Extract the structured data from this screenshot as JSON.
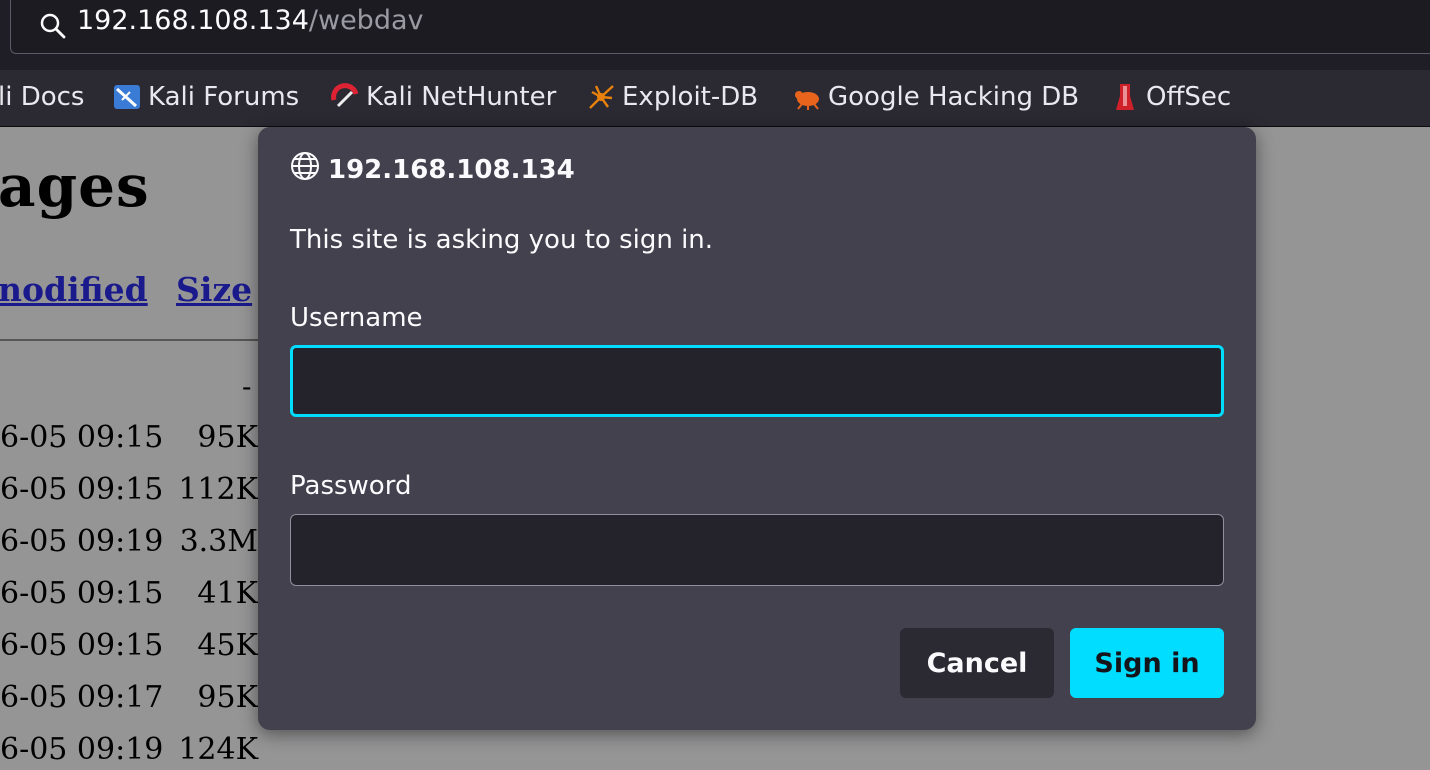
{
  "urlbar": {
    "host": "192.168.108.134",
    "path": "/webdav"
  },
  "bookmarks": [
    {
      "label": "li Docs",
      "icon": "kali-docs-icon"
    },
    {
      "label": "Kali Forums",
      "icon": "kali-forums-icon"
    },
    {
      "label": "Kali NetHunter",
      "icon": "kali-nethunter-icon"
    },
    {
      "label": "Exploit-DB",
      "icon": "exploit-db-icon"
    },
    {
      "label": "Google Hacking DB",
      "icon": "ghdb-icon"
    },
    {
      "label": "OffSec",
      "icon": "offsec-icon"
    }
  ],
  "page": {
    "heading": "ages",
    "columns": [
      "nodified",
      "Size"
    ],
    "parent_size": "-",
    "rows": [
      {
        "date": "6-05 09:15",
        "size": "95K"
      },
      {
        "date": "6-05 09:15",
        "size": "112K"
      },
      {
        "date": "6-05 09:19",
        "size": "3.3M"
      },
      {
        "date": "6-05 09:15",
        "size": "41K"
      },
      {
        "date": "6-05 09:15",
        "size": "45K"
      },
      {
        "date": "6-05 09:17",
        "size": "95K"
      },
      {
        "date": "6-05 09:19",
        "size": "124K"
      }
    ]
  },
  "dialog": {
    "host": "192.168.108.134",
    "message": "This site is asking you to sign in.",
    "username_label": "Username",
    "username_value": "",
    "password_label": "Password",
    "password_value": "",
    "cancel_label": "Cancel",
    "signin_label": "Sign in"
  },
  "colors": {
    "accent": "#00ddff",
    "dialog_bg": "#42414d",
    "toolbar_bg": "#2b2a33"
  }
}
